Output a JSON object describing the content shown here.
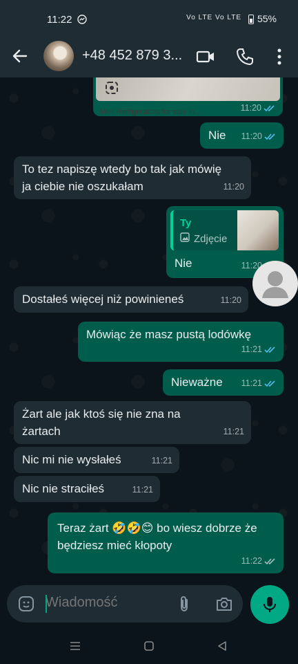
{
  "status_bar": {
    "time": "11:22",
    "network": "Vo LTE Vo LTE",
    "battery": "55%"
  },
  "header": {
    "contact_name": "+48 452 879 3..."
  },
  "image_message": {
    "caption": "Mini Refrigerators for sale in...",
    "time": "11:20"
  },
  "messages": [
    {
      "direction": "out",
      "text": "Nie",
      "time": "11:20",
      "read": true
    },
    {
      "direction": "in",
      "text": "To tez napiszę wtedy bo tak jak mówię ja ciebie nie oszukałam",
      "time": "11:20"
    },
    {
      "direction": "out",
      "text": "Nie",
      "time": "11:20",
      "read": true,
      "reply": {
        "author": "Ty",
        "type": "Zdjęcie"
      }
    },
    {
      "direction": "in",
      "text": "Dostałeś więcej niż powinieneś",
      "time": "11:20"
    },
    {
      "direction": "out",
      "text": "Mówiąc że masz pustą lodówkę",
      "time": "11:21",
      "read": true
    },
    {
      "direction": "out",
      "text": "Nieważne",
      "time": "11:21",
      "read": true
    },
    {
      "direction": "in",
      "text": "Żart ale jak ktoś się nie zna na żartach",
      "time": "11:21"
    },
    {
      "direction": "in",
      "text": "Nic mi nie wysłałeś",
      "time": "11:21"
    },
    {
      "direction": "in",
      "text": "Nic nie straciłeś",
      "time": "11:21"
    },
    {
      "direction": "out",
      "text": "Teraz żart 🤣🤣😊 bo wiesz dobrze że będziesz mieć kłopoty",
      "time": "11:22",
      "read": false
    }
  ],
  "composer": {
    "placeholder": "Wiadomość"
  },
  "colors": {
    "incoming_bubble": "#1f2c34",
    "outgoing_bubble": "#005c4b",
    "accent": "#00a884",
    "read_tick": "#53bdeb",
    "background": "#0b141a"
  },
  "icons": [
    "back-arrow-icon",
    "video-call-icon",
    "phone-icon",
    "more-vert-icon",
    "emoji-icon",
    "attach-icon",
    "camera-icon",
    "mic-icon",
    "double-tick-icon",
    "photo-icon",
    "lens-icon"
  ]
}
